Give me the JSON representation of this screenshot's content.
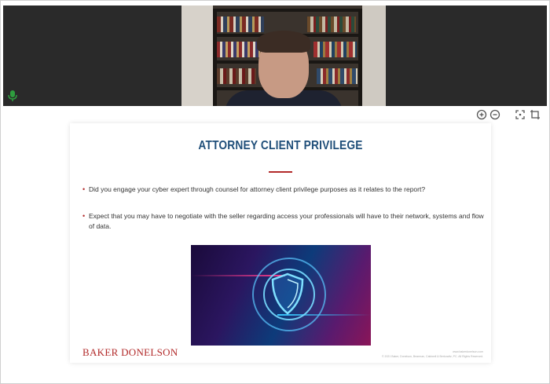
{
  "controls": {
    "zoom_in_icon": "zoom-in-icon",
    "zoom_out_icon": "zoom-out-icon",
    "fit_screen_icon": "fit-screen-icon",
    "crop_icon": "crop-icon"
  },
  "slide": {
    "title": "ATTORNEY CLIENT PRIVILEGE",
    "bullets": [
      "Did you engage your cyber expert through counsel for attorney client privilege purposes as it relates to the report?",
      "Expect that you may have to negotiate with the seller regarding access your professionals will have to their network, systems and flow of data."
    ],
    "footer_brand": "BAKER DONELSON",
    "footer_url": "www.bakerdonelson.com",
    "footer_copyright": "© 2021 Baker, Donelson, Bearman, Caldwell & Berkowitz, PC. All Rights Reserved."
  },
  "colors": {
    "title": "#1f4e79",
    "accent": "#b22a2a",
    "mic_active": "#2e9e3e"
  }
}
